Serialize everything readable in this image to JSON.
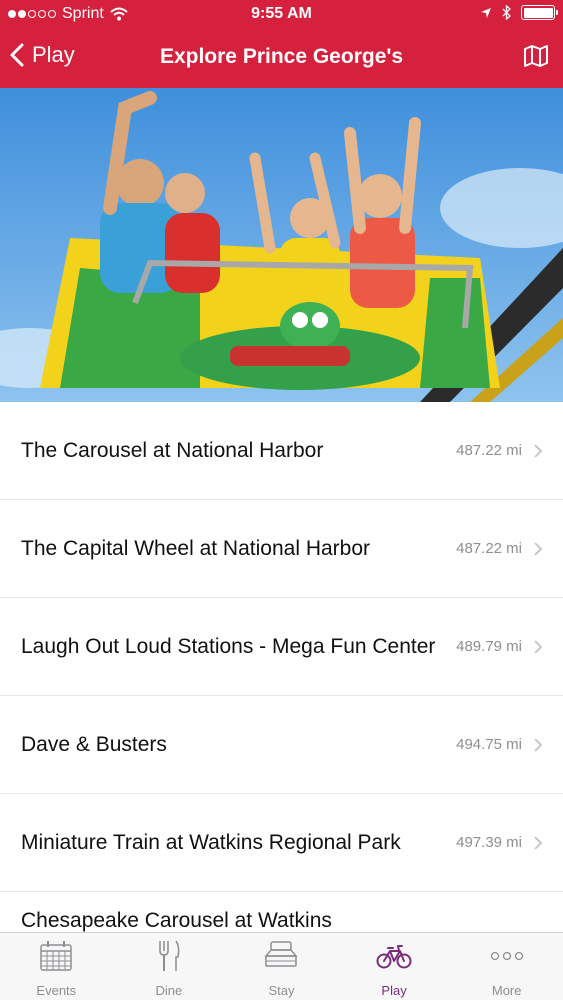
{
  "status_bar": {
    "carrier": "Sprint",
    "time": "9:55 AM"
  },
  "nav": {
    "back_label": "Play",
    "title": "Explore Prince George's"
  },
  "attractions": [
    {
      "name": "The Carousel at National Harbor",
      "distance": "487.22 mi"
    },
    {
      "name": "The Capital Wheel at National Harbor",
      "distance": "487.22 mi"
    },
    {
      "name": "Laugh Out Loud Stations - Mega Fun Center",
      "distance": "489.79 mi"
    },
    {
      "name": "Dave & Busters",
      "distance": "494.75 mi"
    },
    {
      "name": "Miniature Train at Watkins Regional Park",
      "distance": "497.39 mi"
    },
    {
      "name": "Chesapeake Carousel at Watkins",
      "distance": ""
    }
  ],
  "tabs": [
    {
      "label": "Events",
      "icon": "calendar-icon"
    },
    {
      "label": "Dine",
      "icon": "fork-knife-icon"
    },
    {
      "label": "Stay",
      "icon": "bed-icon"
    },
    {
      "label": "Play",
      "icon": "bicycle-icon",
      "active": true
    },
    {
      "label": "More",
      "icon": "more-dots-icon"
    }
  ],
  "colors": {
    "brand": "#d5203e",
    "active_tab": "#7a2e7a",
    "secondary_text": "#8e8e93"
  }
}
